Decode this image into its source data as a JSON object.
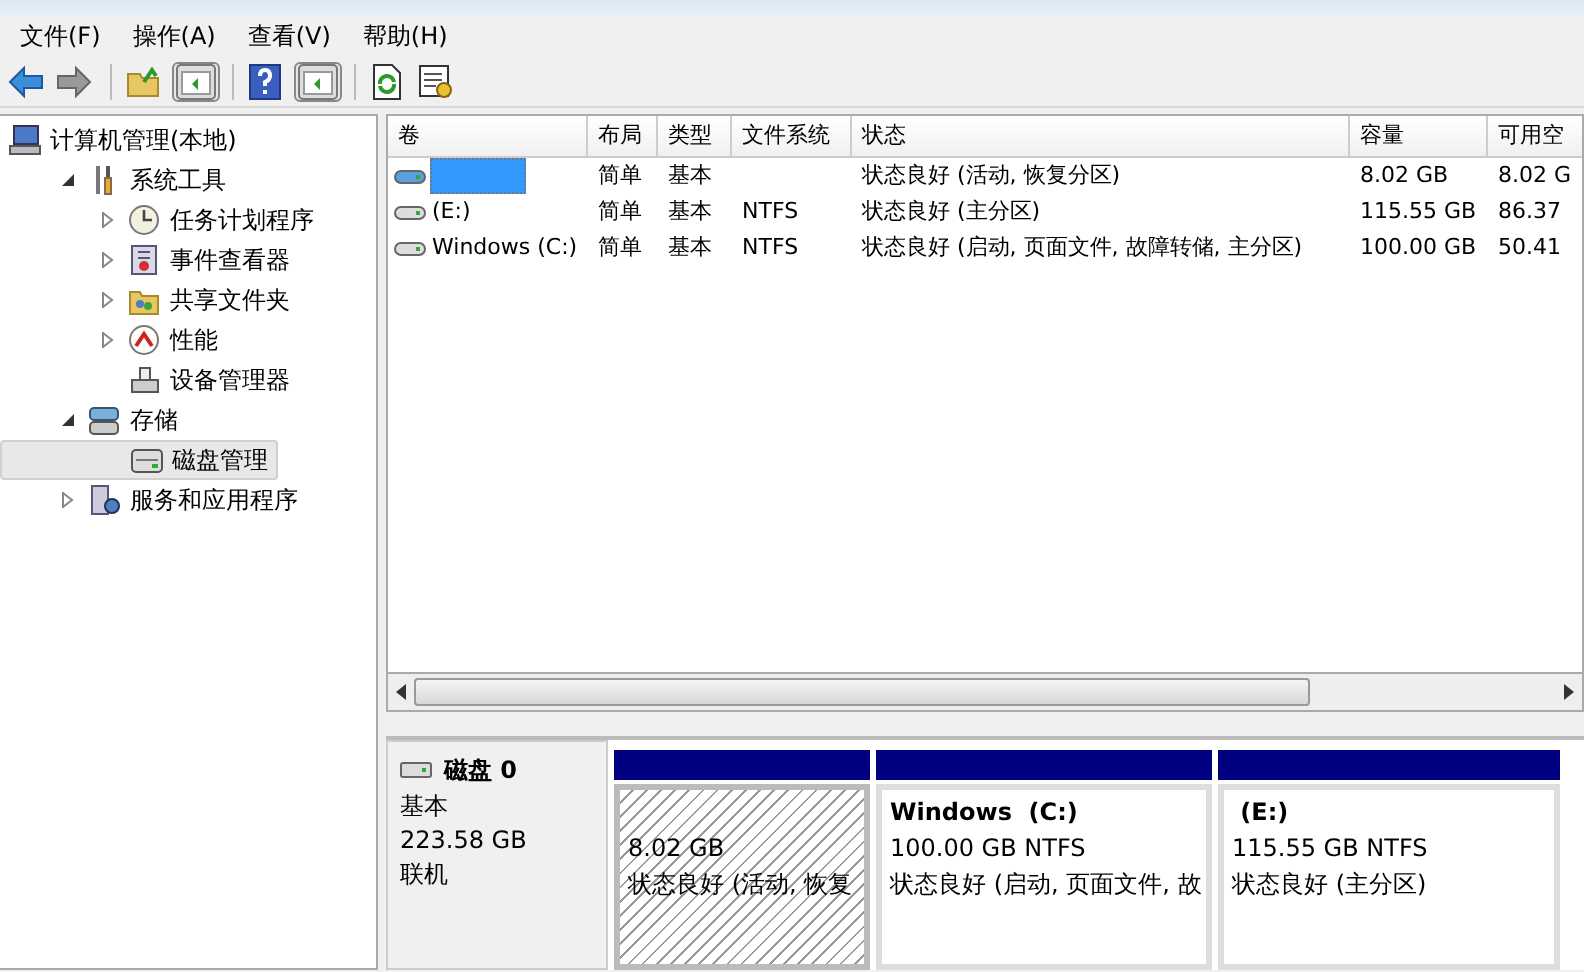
{
  "menu": [
    "文件(F)",
    "操作(A)",
    "查看(V)",
    "帮助(H)"
  ],
  "toolbar": [
    {
      "kind": "back"
    },
    {
      "kind": "forward"
    },
    {
      "kind": "sep"
    },
    {
      "kind": "folder-up"
    },
    {
      "kind": "pane"
    },
    {
      "kind": "sep"
    },
    {
      "kind": "help"
    },
    {
      "kind": "pane"
    },
    {
      "kind": "sep"
    },
    {
      "kind": "refresh"
    },
    {
      "kind": "properties"
    }
  ],
  "tree": [
    {
      "label": "计算机管理(本地)",
      "kind": "computer",
      "selected": false,
      "children": [
        {
          "label": "系统工具",
          "kind": "tools",
          "expanded": true,
          "selected": false,
          "children": [
            {
              "label": "任务计划程序",
              "kind": "clock",
              "expanded": false,
              "selected": false
            },
            {
              "label": "事件查看器",
              "kind": "log",
              "expanded": false,
              "selected": false
            },
            {
              "label": "共享文件夹",
              "kind": "folder",
              "expanded": false,
              "selected": false
            },
            {
              "label": "性能",
              "kind": "gauge",
              "expanded": false,
              "selected": false
            },
            {
              "label": "设备管理器",
              "kind": "device",
              "selected": false
            }
          ]
        },
        {
          "label": "存储",
          "kind": "storage",
          "expanded": true,
          "selected": false,
          "children": [
            {
              "label": "磁盘管理",
              "kind": "disk",
              "selected": true
            }
          ]
        },
        {
          "label": "服务和应用程序",
          "kind": "services",
          "expanded": false,
          "selected": false
        }
      ]
    }
  ],
  "table": {
    "columns": [
      "卷",
      "布局",
      "类型",
      "文件系统",
      "状态",
      "容量",
      "可用空"
    ],
    "rows": [
      {
        "selected": true,
        "kind": "recovery",
        "cells": [
          null,
          "简单",
          "基本",
          null,
          "状态良好 (活动, 恢复分区)",
          "8.02 GB",
          "8.02 G"
        ]
      },
      {
        "selected": false,
        "kind": "volume",
        "cells": [
          " (E:)",
          "简单",
          "基本",
          "NTFS",
          "状态良好 (主分区)",
          "115.55 GB",
          "86.37"
        ]
      },
      {
        "selected": false,
        "kind": "volume",
        "cells": [
          "Windows (C:)",
          "简单",
          "基本",
          "NTFS",
          "状态良好 (启动, 页面文件, 故障转储, 主分区)",
          "100.00 GB",
          "50.41"
        ]
      }
    ]
  },
  "disk": {
    "name": "磁盘 0",
    "type": "基本",
    "size": "223.58 GB",
    "status": "联机",
    "partitions": [
      {
        "hatched": true,
        "size": "8.02 GB",
        "status": "状态良好 (活动, 恢复"
      },
      {
        "hatched": false,
        "title": "Windows  (C:)",
        "size": "100.00 GB NTFS",
        "status": "状态良好 (启动, 页面文件, 故"
      },
      {
        "hatched": false,
        "title": " (E:)",
        "size": "115.55 GB NTFS",
        "status": "状态良好 (主分区)"
      }
    ]
  }
}
